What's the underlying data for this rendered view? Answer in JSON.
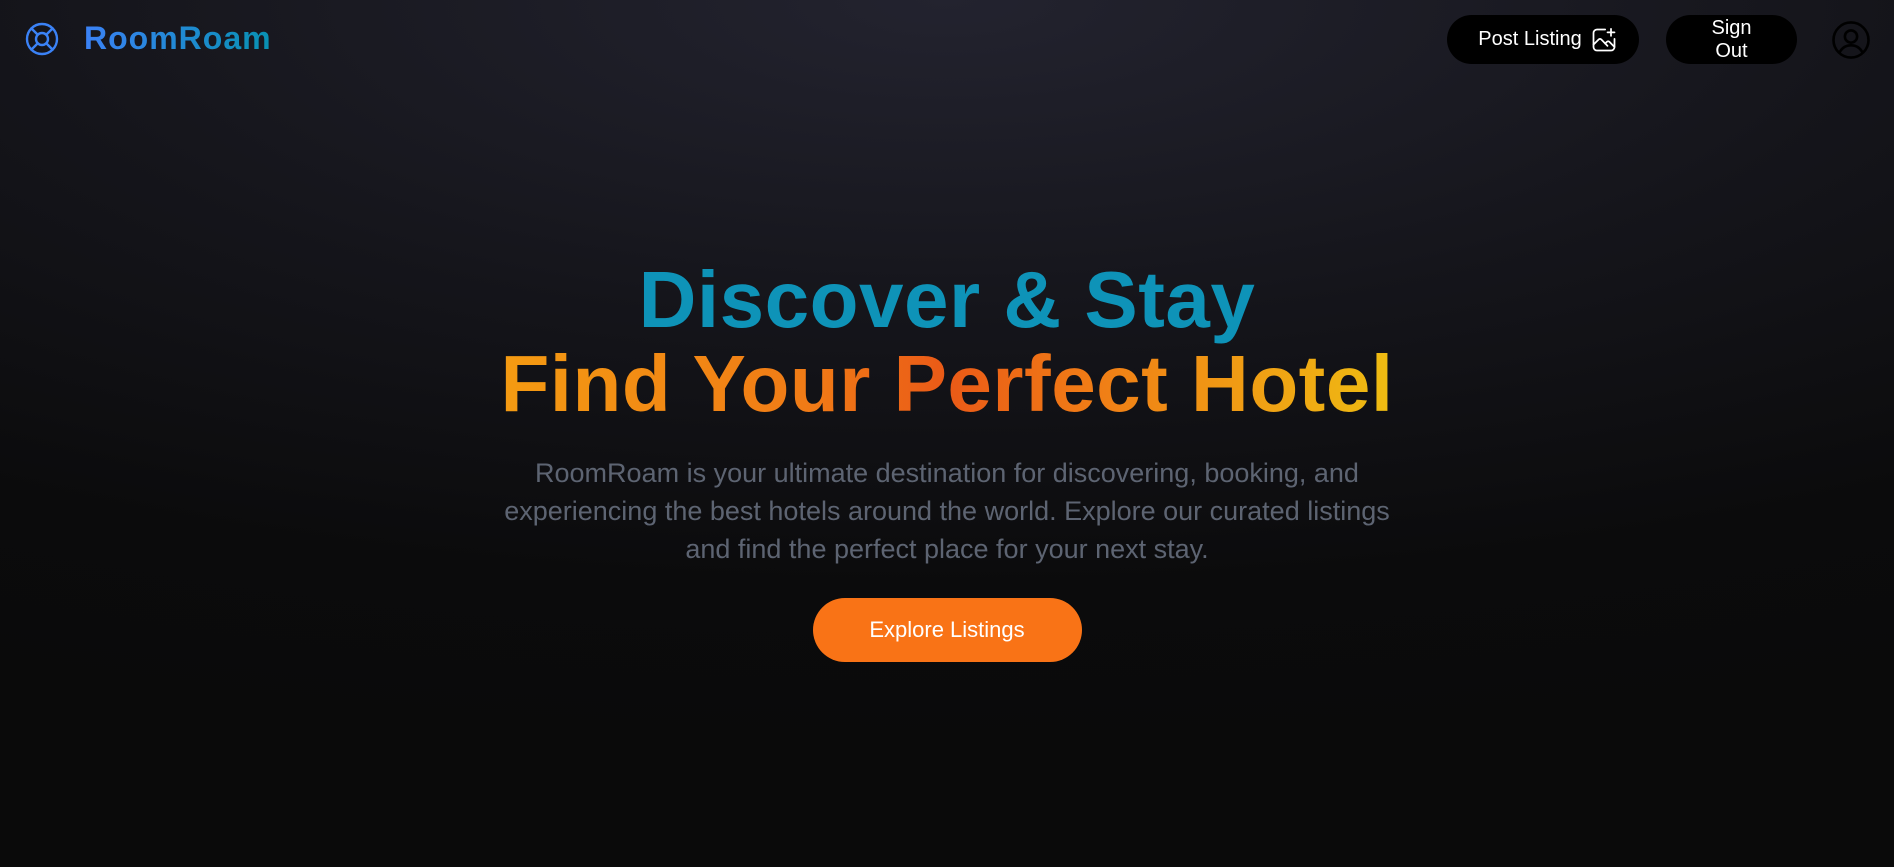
{
  "brand": {
    "name": "RoomRoam",
    "icon": "lifebuoy-icon",
    "gradient": [
      "#3b82f6",
      "#0891b2"
    ]
  },
  "nav": {
    "post_listing_label": "Post Listing",
    "post_listing_icon": "image-plus-icon",
    "sign_out_label": "Sign Out",
    "profile_icon": "user-circle-icon"
  },
  "hero": {
    "title_line1": "Discover & Stay",
    "title_line2": "Find Your Perfect Hotel",
    "description": "RoomRoam is your ultimate destination for discovering, booking, and experiencing the best hotels around the world. Explore our curated listings and find the perfect place for your next stay.",
    "cta_label": "Explore Listings"
  },
  "colors": {
    "background": "#0a0a0a",
    "title_line1": "#0e93b8",
    "title_line2_gradient": [
      "#f49b12",
      "#ea5a17",
      "#efbd12"
    ],
    "description": "#5d6472",
    "cta": "#f97316",
    "nav_button": "#000000"
  }
}
